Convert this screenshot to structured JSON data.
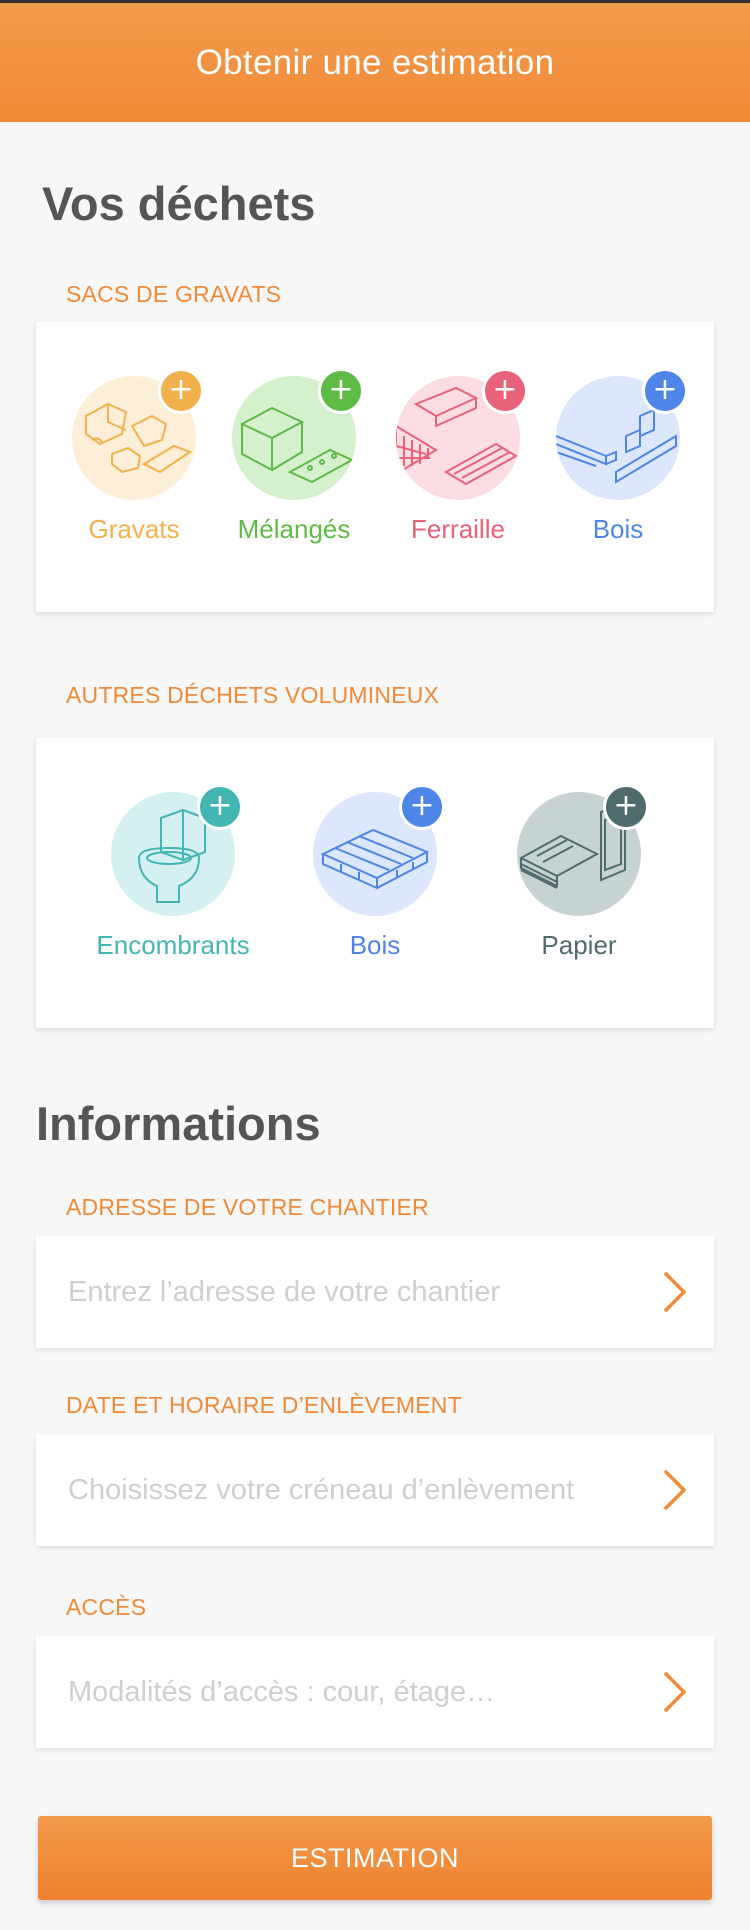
{
  "header": {
    "title": "Obtenir une estimation"
  },
  "waste": {
    "heading": "Vos déchets",
    "rubble_section": {
      "label": "SACS DE GRAVATS",
      "items": [
        {
          "label": "Gravats",
          "color": "#f2b14d",
          "bg": "#fdeed8",
          "icon": "rubble-icon"
        },
        {
          "label": "Mélangés",
          "color": "#5dbb46",
          "bg": "#d4f0cd",
          "icon": "mixed-waste-icon"
        },
        {
          "label": "Ferraille",
          "color": "#e8627a",
          "bg": "#fbdde3",
          "icon": "scrap-metal-icon"
        },
        {
          "label": "Bois",
          "color": "#4d86e8",
          "bg": "#dce6fc",
          "icon": "wood-planks-icon"
        }
      ]
    },
    "bulky_section": {
      "label": "AUTRES DÉCHETS VOLUMINEUX",
      "items": [
        {
          "label": "Encombrants",
          "color": "#43b6b3",
          "bg": "#d5f0f0",
          "icon": "toilet-icon"
        },
        {
          "label": "Bois",
          "color": "#4d86e8",
          "bg": "#dce6fc",
          "icon": "pallet-icon"
        },
        {
          "label": "Papier",
          "color": "#4f6b6d",
          "bg": "#c7d3d2",
          "icon": "paper-icon"
        }
      ]
    }
  },
  "info": {
    "heading": "Informations",
    "address": {
      "label": "ADRESSE DE VOTRE CHANTIER",
      "placeholder": "Entrez l’adresse de votre chantier"
    },
    "date": {
      "label": "DATE ET HORAIRE D’ENLÈVEMENT",
      "placeholder": "Choisissez votre créneau d’enlèvement"
    },
    "access": {
      "label": "ACCÈS",
      "placeholder": "Modalités d’accès : cour, étage…"
    }
  },
  "cta": {
    "label": "ESTIMATION"
  },
  "colors": {
    "accent": "#ef8a38",
    "heading": "#555555",
    "placeholder": "#cfcfcf"
  }
}
